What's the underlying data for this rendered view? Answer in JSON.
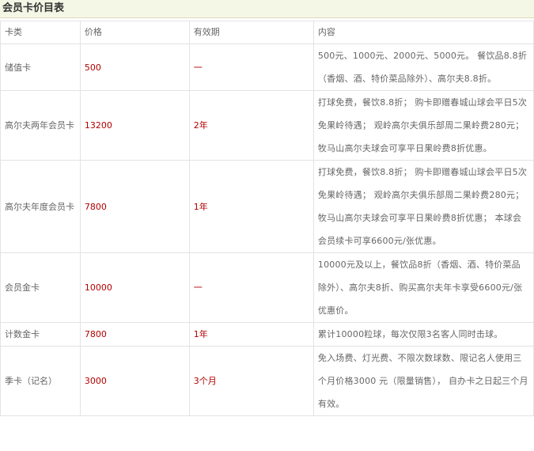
{
  "title": "会员卡价目表",
  "headers": {
    "type": "卡类",
    "price": "价格",
    "validity": "有效期",
    "content": "内容"
  },
  "rows": [
    {
      "type": "储值卡",
      "price": "500",
      "validity": "一",
      "content": "500元、1000元、2000元、5000元。 餐饮品8.8折（香烟、酒、特价菜品除外）、高尔夫8.8折。"
    },
    {
      "type": "高尔夫两年会员卡",
      "price": "13200",
      "validity": "2年",
      "content": "打球免费，餐饮8.8折； 购卡即赠春城山球会平日5次免果岭待遇； 观岭高尔夫俱乐部周二果岭费280元； 牧马山高尔夫球会可享平日果岭费8折优惠。"
    },
    {
      "type": "高尔夫年度会员卡",
      "price": "7800",
      "validity": "1年",
      "content": "打球免费，餐饮8.8折； 购卡即赠春城山球会平日5次免果岭待遇； 观岭高尔夫俱乐部周二果岭费280元； 牧马山高尔夫球会可享平日果岭费8折优惠； 本球会会员续卡可享6600元/张优惠。"
    },
    {
      "type": "会员金卡",
      "price": "10000",
      "validity": "一",
      "content": "10000元及以上，餐饮品8折（香烟、酒、特价菜品除外）、高尔夫8折、购买高尔夫年卡享受6600元/张优惠价。"
    },
    {
      "type": "计数金卡",
      "price": "7800",
      "validity": "1年",
      "content": "累计10000粒球，每次仅限3名客人同时击球。"
    },
    {
      "type": "季卡（记名）",
      "price": "3000",
      "validity": "3个月",
      "content": "免入场费、灯光费、不限次数球数、限记名人使用三个月价格3000 元（限量销售）， 自办卡之日起三个月有效。"
    }
  ]
}
